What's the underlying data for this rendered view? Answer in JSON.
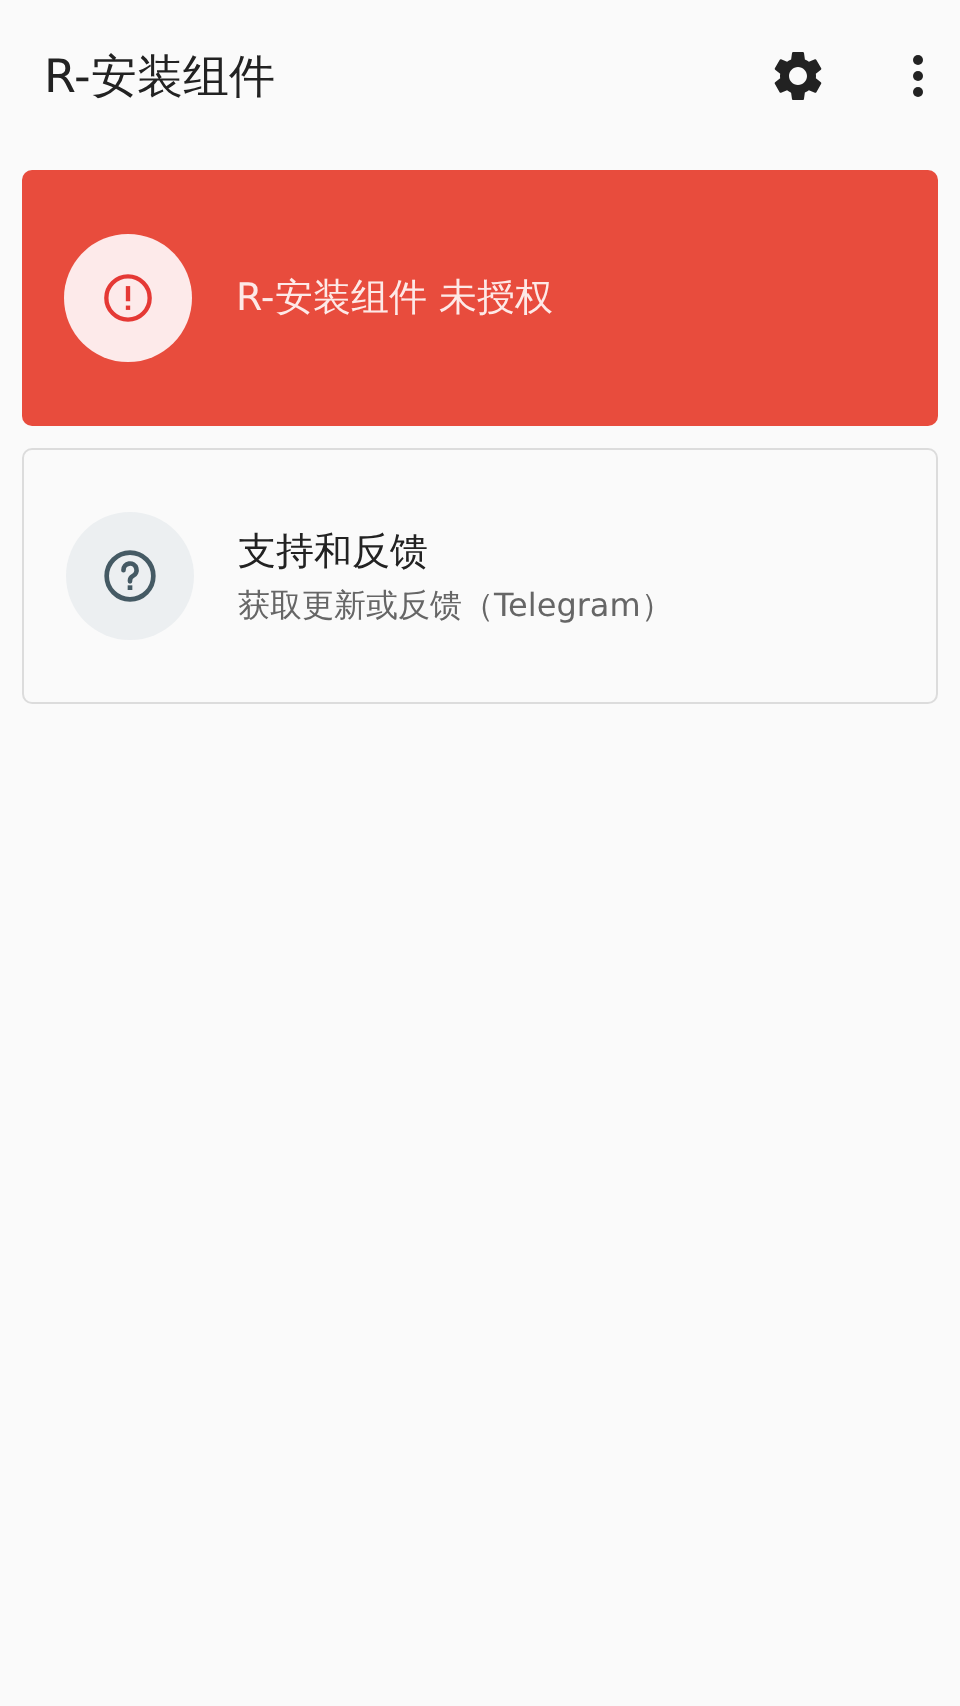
{
  "app_bar": {
    "title": "R-安装组件"
  },
  "cards": [
    {
      "kind": "alert",
      "title": "R-安装组件 未授权"
    },
    {
      "kind": "link",
      "title": "支持和反馈",
      "subtitle": "获取更新或反馈（Telegram）"
    }
  ]
}
